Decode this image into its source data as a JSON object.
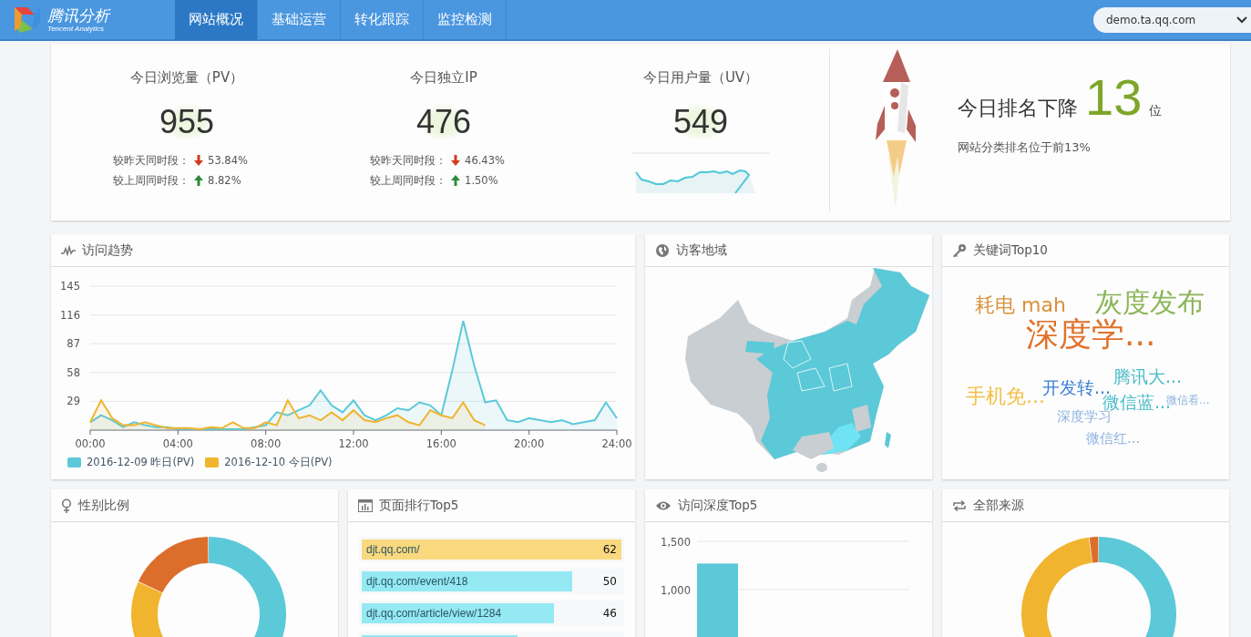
{
  "header": {
    "logo_title": "腾讯分析",
    "logo_subtitle": "Tencent Analytics",
    "tabs": [
      {
        "label": "网站概况",
        "selected": true
      },
      {
        "label": "基础运营",
        "selected": false
      },
      {
        "label": "转化跟踪",
        "selected": false
      },
      {
        "label": "监控检测",
        "selected": false
      }
    ],
    "site_select": {
      "value": "demo.ta.qq.com"
    }
  },
  "summary": {
    "metrics": [
      {
        "title": "今日浏览量（PV）",
        "value": "955",
        "comparisons": [
          {
            "label": "较昨天同时段：",
            "increase": false,
            "value": "53.84%"
          },
          {
            "label": "较上周同时段：",
            "increase": true,
            "value": "8.82%"
          }
        ]
      },
      {
        "title": "今日独立IP",
        "value": "476",
        "comparisons": [
          {
            "label": "较昨天同时段：",
            "increase": false,
            "value": "46.43%"
          },
          {
            "label": "较上周同时段：",
            "increase": true,
            "value": "1.50%"
          }
        ]
      },
      {
        "title": "今日用户量（UV）",
        "value": "549",
        "sparkline": true
      }
    ],
    "ranking": {
      "label": "今日排名下降",
      "value": "13",
      "unit": "位",
      "note": "网站分类排名位于前13%"
    }
  },
  "trend_card": {
    "title": "访问趋势",
    "chart_data": {
      "type": "area",
      "grid": true,
      "legend": "bottom",
      "x": [
        0,
        0.5,
        1,
        1.5,
        2,
        2.5,
        3,
        3.5,
        4,
        4.5,
        5,
        5.5,
        6,
        6.5,
        7,
        7.5,
        8,
        8.5,
        9,
        9.5,
        10,
        10.5,
        11,
        11.5,
        12,
        12.5,
        13,
        13.5,
        14,
        14.5,
        15,
        15.5,
        16,
        16.5,
        17,
        17.5,
        18,
        18.5,
        19,
        19.5,
        20,
        20.5,
        21,
        21.5,
        22,
        22.5,
        23,
        23.5,
        24
      ],
      "series": [
        {
          "name": "2016-12-09 昨日(PV)",
          "color": "#5bc9d8",
          "values": [
            8,
            15,
            10,
            3,
            8,
            5,
            3,
            3,
            1,
            1,
            1,
            1,
            1,
            1,
            1,
            3,
            5,
            18,
            15,
            20,
            25,
            40,
            25,
            18,
            30,
            15,
            10,
            15,
            22,
            20,
            28,
            25,
            15,
            60,
            110,
            65,
            28,
            30,
            10,
            8,
            12,
            10,
            8,
            10,
            6,
            8,
            10,
            28,
            12
          ]
        },
        {
          "name": "2016-12-10 今日(PV)",
          "color": "#f0b42e",
          "values": [
            8,
            30,
            12,
            5,
            5,
            8,
            5,
            2,
            2,
            2,
            1,
            3,
            2,
            8,
            2,
            2,
            8,
            5,
            30,
            12,
            15,
            10,
            18,
            10,
            20,
            10,
            8,
            12,
            15,
            8,
            5,
            20,
            15,
            12,
            28,
            10,
            5,
            null,
            null,
            null,
            null,
            null,
            null,
            null,
            null,
            null,
            null,
            null,
            null
          ]
        }
      ],
      "ylim": [
        0,
        145
      ],
      "yticks": [
        29,
        58,
        87,
        116,
        145
      ],
      "xlim": [
        0,
        24
      ],
      "xticks": [
        {
          "value": 0,
          "label": "00:00"
        },
        {
          "value": 4,
          "label": "04:00"
        },
        {
          "value": 8,
          "label": "08:00"
        },
        {
          "value": 12,
          "label": "12:00"
        },
        {
          "value": 16,
          "label": "16:00"
        },
        {
          "value": 20,
          "label": "20:00"
        },
        {
          "value": 24,
          "label": "24:00"
        }
      ]
    }
  },
  "region_card": {
    "title": "访客地域"
  },
  "keyword_card": {
    "title": "关键词Top10",
    "words": [
      {
        "text": "耗电 mah",
        "kind": "medium",
        "color": "#d9913a"
      },
      {
        "text": "灰度发布",
        "kind": "large",
        "color": "#8db55a"
      },
      {
        "text": "深度学...",
        "kind": "huge",
        "color": "#e0712a"
      },
      {
        "text": "腾讯大...",
        "kind": "normal",
        "color": "#4bbcc8"
      },
      {
        "text": "开发转...",
        "kind": "normal",
        "color": "#3a7fd5"
      },
      {
        "text": "手机免...",
        "kind": "medium",
        "color": "#f2c04a"
      },
      {
        "text": "微信蓝...",
        "kind": "normal",
        "color": "#4bbcc8"
      },
      {
        "text": "微信看...",
        "kind": "tiny",
        "color": "#8fb3e0"
      },
      {
        "text": "深度学习",
        "kind": "small",
        "color": "#8fb3e0"
      },
      {
        "text": "微信红...",
        "kind": "small",
        "color": "#8fb3e0"
      }
    ]
  },
  "gender_card": {
    "title": "性别比例"
  },
  "pages_card": {
    "title": "页面排行Top5",
    "rows": [
      {
        "url": "djt.qq.com/",
        "count": "62",
        "level": 1,
        "highlight": true
      },
      {
        "url": "djt.qq.com/event/418",
        "count": "50",
        "level": 0.81,
        "highlight": false
      },
      {
        "url": "djt.qq.com/article/view/1284",
        "count": "46",
        "level": 0.74,
        "highlight": false
      },
      {
        "level": 0.6,
        "highlight": false
      }
    ]
  },
  "depth_card": {
    "title": "访问深度Top5",
    "chart_data": {
      "type": "bar",
      "ylim": [
        0,
        1500
      ],
      "grid": true,
      "yticks": [
        {
          "value": 1000,
          "label": "1,000"
        },
        {
          "value": 1500,
          "label": "1,500"
        }
      ],
      "values": [
        1270
      ]
    }
  },
  "source_card": {
    "title": "全部来源"
  }
}
